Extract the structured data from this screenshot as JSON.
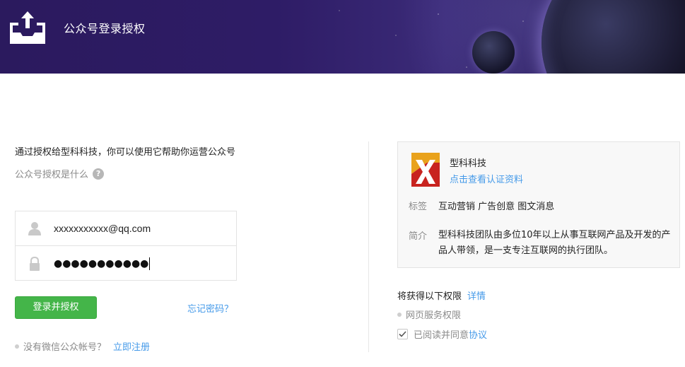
{
  "header": {
    "title": "公众号登录授权",
    "logo_icon": "upload-tray-icon"
  },
  "left": {
    "intro": "通过授权给型科科技，你可以使用它帮助你运营公众号",
    "what_is": "公众号授权是什么",
    "help_icon": "question-mark-icon",
    "account_value": "xxxxxxxxxxx@qq.com",
    "password_value": "●●●●●●●●●●●",
    "user_icon": "user-icon",
    "lock_icon": "lock-icon",
    "login_button": "登录并授权",
    "forgot_link": "忘记密码？",
    "no_account_text": "没有微信公众帐号？",
    "register_link": "立即注册"
  },
  "card": {
    "name": "型科科技",
    "view_cert": "点击查看认证资料",
    "tag_label": "标签",
    "tag_value": "互动营销 广告创意 图文消息",
    "intro_label": "简介",
    "intro_value": "型科科技团队由多位10年以上从事互联网产品及开发的产品人带领，是一支专注互联网的执行团队。"
  },
  "permissions": {
    "title": "将获得以下权限",
    "detail_link": "详情",
    "item": "网页服务权限",
    "agree_prefix": "已阅读并同意",
    "agree_link": "协议",
    "agree_checked": true
  },
  "colors": {
    "accent_green": "#44b549",
    "link_blue": "#459ae9"
  }
}
